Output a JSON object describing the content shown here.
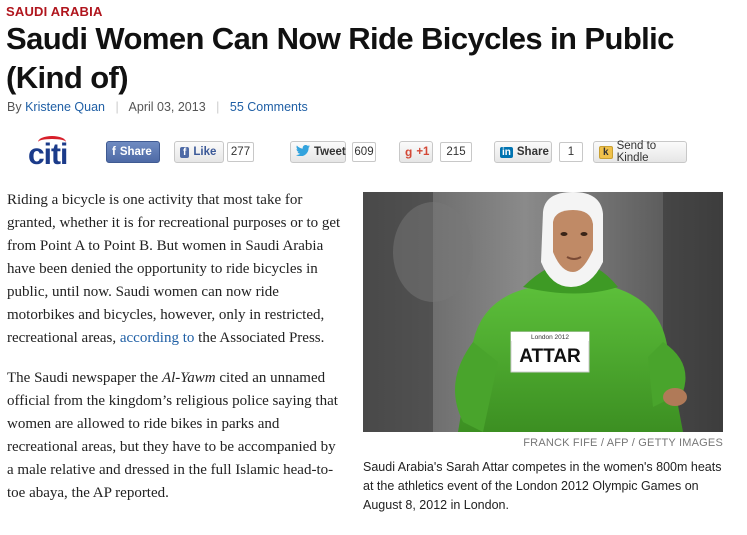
{
  "article": {
    "section": "SAUDI ARABIA",
    "headline": "Saudi Women Can Now Ride Bicycles in Public (Kind of)",
    "byline": {
      "prefix": "By",
      "author": "Kristene Quan",
      "date": "April 03, 2013",
      "comments": "55 Comments"
    },
    "body": {
      "p1_text": "Riding a bicycle is one activity that most take for granted, whether it is for recreational purposes or to get from Point A to Point B. But women in Saudi Arabia have been denied the opportunity to ride bicycles in public, until now. Saudi women can now ride motorbikes and bicycles, however, only in restricted, recreational areas, ",
      "p1_link": "according to",
      "p1_end": " the Associated Press.",
      "p2_start": "The Saudi newspaper the ",
      "p2_italic": "Al-Yawm",
      "p2_end": " cited an unnamed official from the kingdom’s religious police saying that women are allowed to ride bikes in parks and recreational areas, but they have to be accompanied by a male relative and dressed in the full Islamic head-to-toe abaya, the AP reported."
    },
    "photo": {
      "credit": "FRANCK FIFE / AFP / GETTY IMAGES",
      "caption": "Saudi Arabia's Sarah Attar competes in the women's 800m heats at the athletics event of the London 2012 Olympic Games on August 8, 2012 in London.",
      "bib_name": "ATTAR",
      "bib_event": "London 2012"
    }
  },
  "share_bar": {
    "sponsor": "citi",
    "facebook_share": "Share",
    "facebook_like": "Like",
    "like_count": "277",
    "tweet": "Tweet",
    "tweet_count": "609",
    "gplus": "+1",
    "gplus_count": "215",
    "linkedin": "Share",
    "linkedin_count": "1",
    "kindle": "Send to Kindle"
  },
  "colors": {
    "section_red": "#b0151d",
    "link_blue": "#1f5fa5",
    "citi_blue": "#1b3b8a",
    "facebook_blue": "#4e6aa6"
  }
}
